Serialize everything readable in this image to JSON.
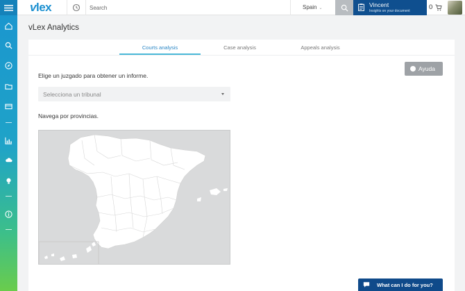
{
  "app": {
    "logo_prefix": "v",
    "logo_suffix": "lex"
  },
  "search": {
    "placeholder": "Search"
  },
  "country": {
    "label": "Spain"
  },
  "user": {
    "name": "Vincent",
    "subtitle": "Insights on your document"
  },
  "cart": {
    "count": "0"
  },
  "page": {
    "title": "vLex Analytics"
  },
  "tabs": [
    {
      "label": "Courts analysis",
      "active": true
    },
    {
      "label": "Case analysis",
      "active": false
    },
    {
      "label": "Appeals analysis",
      "active": false
    }
  ],
  "help": {
    "label": "Ayuda"
  },
  "form": {
    "court_prompt": "Elige un juzgado para obtener un informe.",
    "court_select_placeholder": "Selecciona un tribunal",
    "province_prompt": "Navega por provincias."
  },
  "chat": {
    "label": "What can I do for you?"
  },
  "colors": {
    "brand": "#1a8fd0",
    "user_box": "#0f4f8f",
    "active_tab": "#2a86c5",
    "tab_underline": "#4ab8d8"
  },
  "sidebar": {
    "icons": [
      "menu-icon",
      "home-icon",
      "search-icon",
      "compass-icon",
      "folder-icon",
      "briefcase-icon",
      "chart-icon",
      "cloud-icon",
      "lightbulb-icon",
      "info-icon"
    ]
  }
}
